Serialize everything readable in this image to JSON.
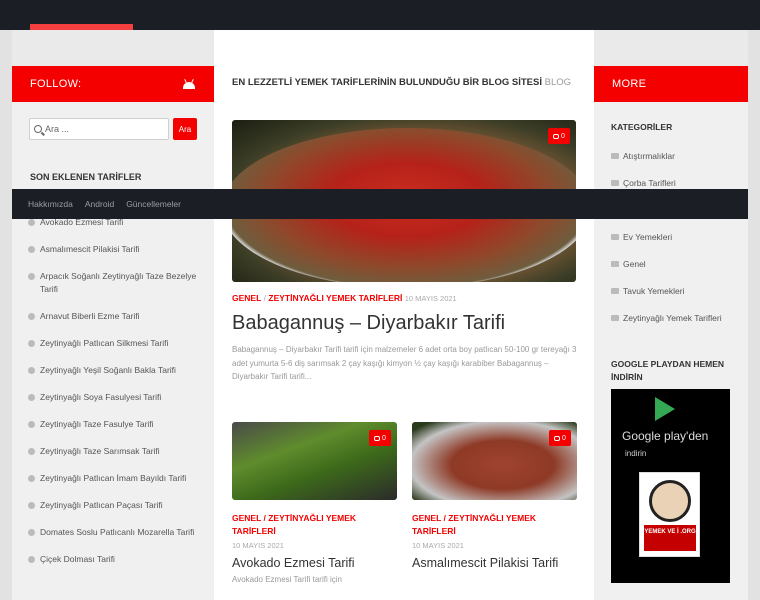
{
  "follow_label": "FOLLOW:",
  "more_label": "MORE",
  "search": {
    "placeholder": "Ara ...",
    "button": "Ara"
  },
  "nav": [
    "Hakkımızda",
    "Android",
    "Güncellemeler"
  ],
  "tagline": {
    "main": "EN LEZZETLİ YEMEK TARİFLERİNİN BULUNDUĞU BİR BLOG SİTESİ",
    "suffix": "BLOG"
  },
  "recent": {
    "title": "SON EKLENEN TARİFLER",
    "items": [
      "Avokado Ezmesi Tarifi",
      "Asmalımescit Pilakisi Tarifi",
      "Arpacık Soğanlı Zeytinyağlı Taze Bezelye Tarifi",
      "Arnavut Biberli Ezme Tarifi",
      "Zeytinyağlı Patlıcan Silkmesi Tarifi",
      "Zeytinyağlı Yeşil Soğanlı Bakla Tarifi",
      "Zeytinyağlı Soya Fasulyesi Tarifi",
      "Zeytinyağlı Taze Fasulye Tarifi",
      "Zeytinyağlı Taze Sarımsak Tarifi",
      "Zeytinyağlı Patlıcan İmam Bayıldı Tarifi",
      "Zeytinyağlı Patlıcan Paçası Tarifi",
      "Domates Soslu Patlıcanlı Mozarella Tarifi",
      "Çiçek Dolması Tarifi"
    ]
  },
  "featured": {
    "cat1": "GENEL",
    "cat2": "ZEYTİNYAĞLI YEMEK TARİFLERİ",
    "date": "10 MAYIS 2021",
    "title": "Babagannuş – Diyarbakır Tarifi",
    "excerpt": "Babagannuş – Diyarbakır Tarifi tarifi için malzemeler 6 adet orta boy patlıcan 50-100 gr tereyağı 3 adet yumurta 5-6 diş sarımsak 2 çay kaşığı kimyon ½ çay kaşığı karabiber Babagannuş – Diyarbakır Tarifi tarifi...",
    "comments": "0"
  },
  "cards": [
    {
      "cats": "GENEL / ZEYTİNYAĞLI YEMEK TARİFLERİ",
      "date": "10 MAYIS 2021",
      "title": "Avokado Ezmesi Tarifi",
      "excerpt": "Avokado Ezmesi Tarifi tarifi için",
      "comments": "0"
    },
    {
      "cats": "GENEL / ZEYTİNYAĞLI YEMEK TARİFLERİ",
      "date": "10 MAYIS 2021",
      "title": "Asmalımescit Pilakisi Tarifi",
      "excerpt": "",
      "comments": "0"
    }
  ],
  "categories": {
    "title": "KATEGORİLER",
    "items": [
      "Atıştırmalıklar",
      "Çorba Tarifleri",
      "",
      "Ev Yemekleri",
      "Genel",
      "Tavuk Yemekleri",
      "Zeytinyağlı Yemek Tarifleri"
    ]
  },
  "google_play": {
    "title": "GOOGLE PLAYDAN HEMEN İNDİRİN",
    "badge_text": "Google play'den",
    "badge_sub": "indirin",
    "logo_text": "YEMEK VE İ .ORG"
  },
  "colors": {
    "accent": "#f40000",
    "dark": "#1b1e24",
    "page": "#e2e2e2"
  }
}
